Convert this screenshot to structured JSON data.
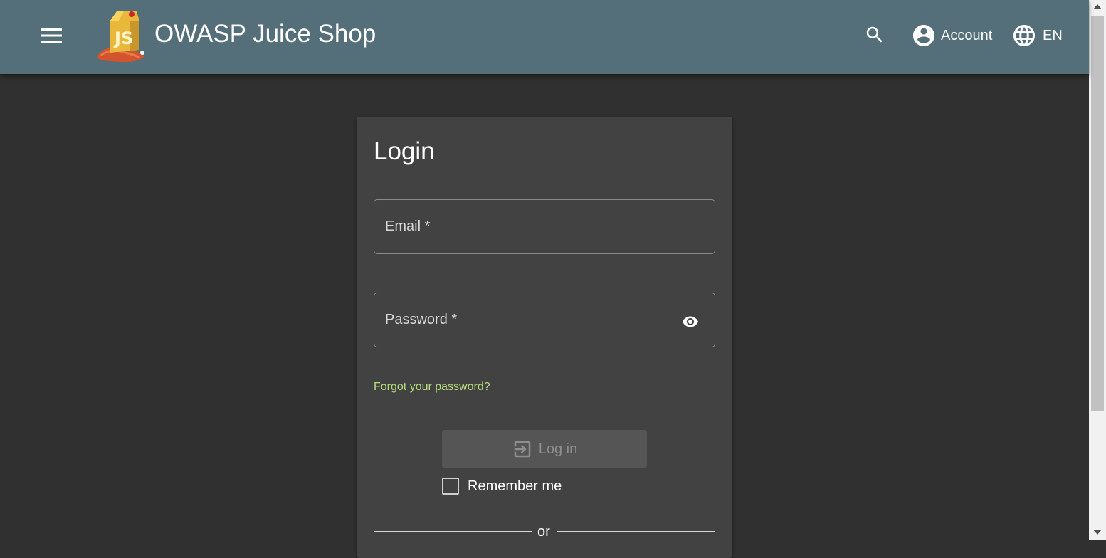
{
  "header": {
    "title": "OWASP Juice Shop",
    "account_label": "Account",
    "language_label": "EN"
  },
  "login": {
    "title": "Login",
    "email_label": "Email *",
    "email_value": "",
    "password_label": "Password *",
    "password_value": "",
    "forgot_password": "Forgot your password?",
    "login_button": "Log in",
    "remember_me": "Remember me",
    "divider_text": "or"
  },
  "icons": {
    "menu": "menu-icon",
    "logo": "juice-shop-logo",
    "search": "search-icon",
    "account": "account-circle-icon",
    "language": "globe-icon",
    "visibility": "eye-icon",
    "login": "exit-to-app-icon"
  },
  "colors": {
    "toolbar": "#546e7a",
    "background": "#303030",
    "card": "#424242",
    "link": "#b5dc7d",
    "button_disabled": "#555555"
  }
}
